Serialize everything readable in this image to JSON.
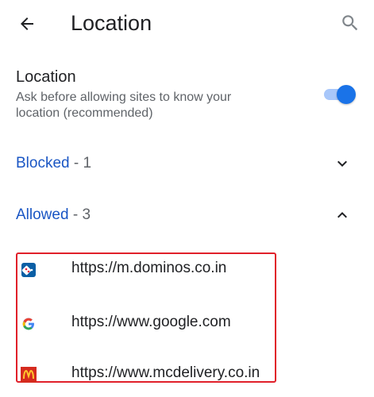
{
  "toolbar": {
    "title": "Location",
    "back_icon": "arrow-back-icon",
    "search_icon": "search-icon"
  },
  "location_setting": {
    "title": "Location",
    "description": "Ask before allowing sites to know your location (recommended)",
    "enabled": true
  },
  "sections": {
    "blocked": {
      "label": "Blocked",
      "separator": " - ",
      "count": "1",
      "expanded": false
    },
    "allowed": {
      "label": "Allowed",
      "separator": " - ",
      "count": "3",
      "expanded": true
    }
  },
  "sites": [
    {
      "url": "https://m.dominos.co.in",
      "favicon": "dominos-icon"
    },
    {
      "url": "https://www.google.com",
      "favicon": "google-icon"
    },
    {
      "url": "https://www.mcdelivery.co.in",
      "favicon": "mcdelivery-icon"
    }
  ],
  "colors": {
    "accent": "#1a73e8",
    "section_label": "#1a56c4",
    "highlight_border": "#e0202a"
  }
}
